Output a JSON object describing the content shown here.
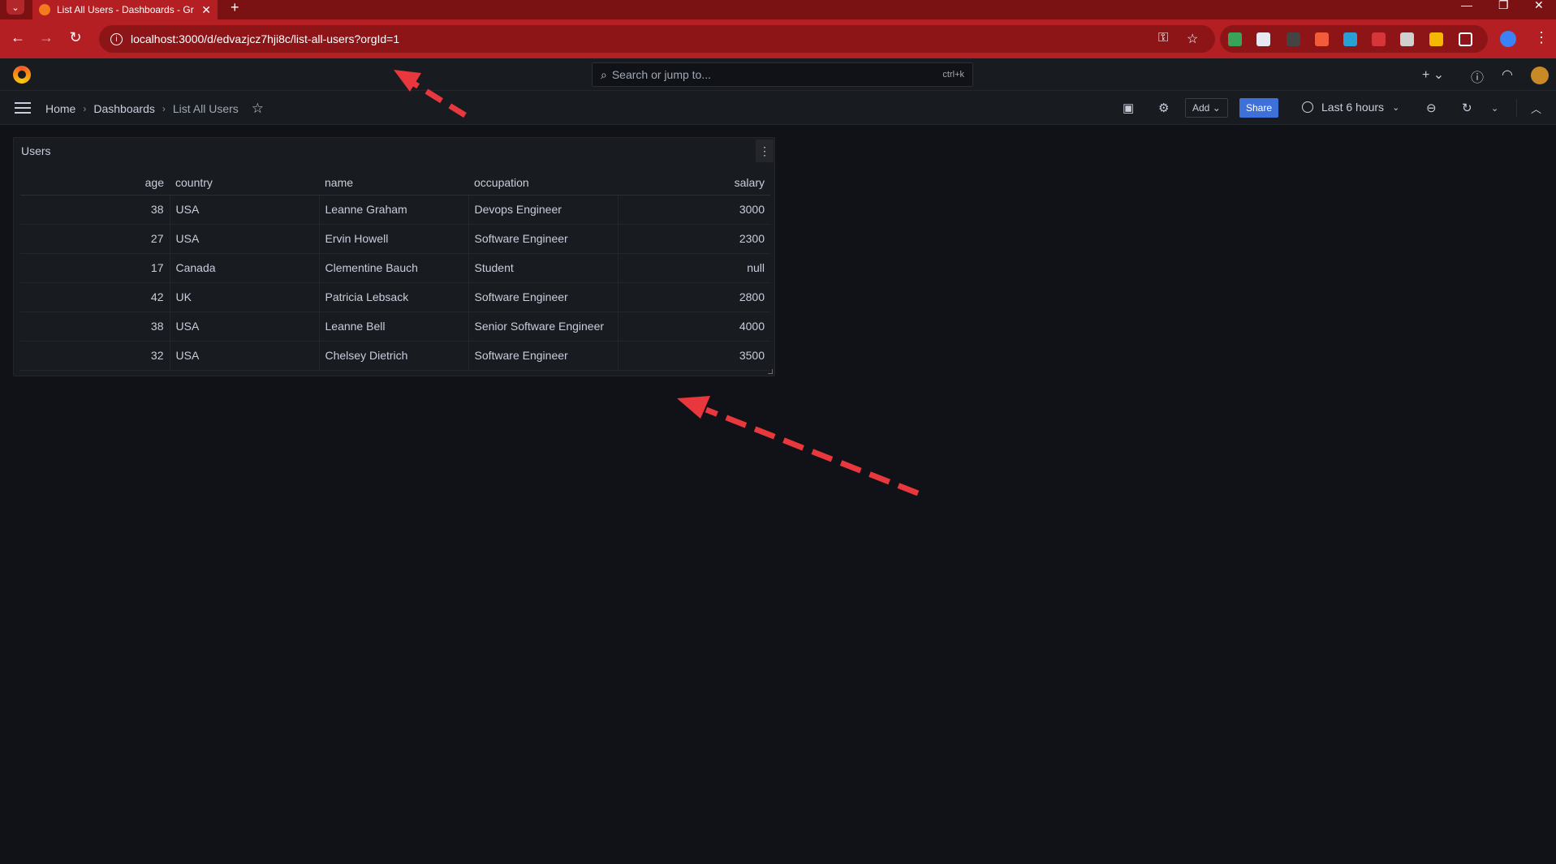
{
  "browser": {
    "tab_title": "List All Users - Dashboards - Gr",
    "url": "localhost:3000/d/edvazjcz7hji8c/list-all-users?orgId=1",
    "new_tab_glyph": "+",
    "window_controls": [
      "—",
      "❐",
      "✕"
    ]
  },
  "grafana": {
    "search_placeholder": "Search or jump to...",
    "search_shortcut": "ctrl+k",
    "breadcrumbs": [
      "Home",
      "Dashboards",
      "List All Users"
    ],
    "add_label": "Add",
    "share_label": "Share",
    "time_range": "Last 6 hours"
  },
  "panel": {
    "title": "Users",
    "columns": [
      "age",
      "country",
      "name",
      "occupation",
      "salary"
    ],
    "rows": [
      [
        "38",
        "USA",
        "Leanne Graham",
        "Devops Engineer",
        "3000"
      ],
      [
        "27",
        "USA",
        "Ervin Howell",
        "Software Engineer",
        "2300"
      ],
      [
        "17",
        "Canada",
        "Clementine Bauch",
        "Student",
        "null"
      ],
      [
        "42",
        "UK",
        "Patricia Lebsack",
        "Software Engineer",
        "2800"
      ],
      [
        "38",
        "USA",
        "Leanne Bell",
        "Senior Software Engineer",
        "4000"
      ],
      [
        "32",
        "USA",
        "Chelsey Dietrich",
        "Software Engineer",
        "3500"
      ]
    ]
  },
  "colors": {
    "browser_frame": "#b31f22",
    "background": "#111217",
    "panel": "#181b1f",
    "share_button": "#3d71d9",
    "annotation_arrow": "#e8383d"
  }
}
